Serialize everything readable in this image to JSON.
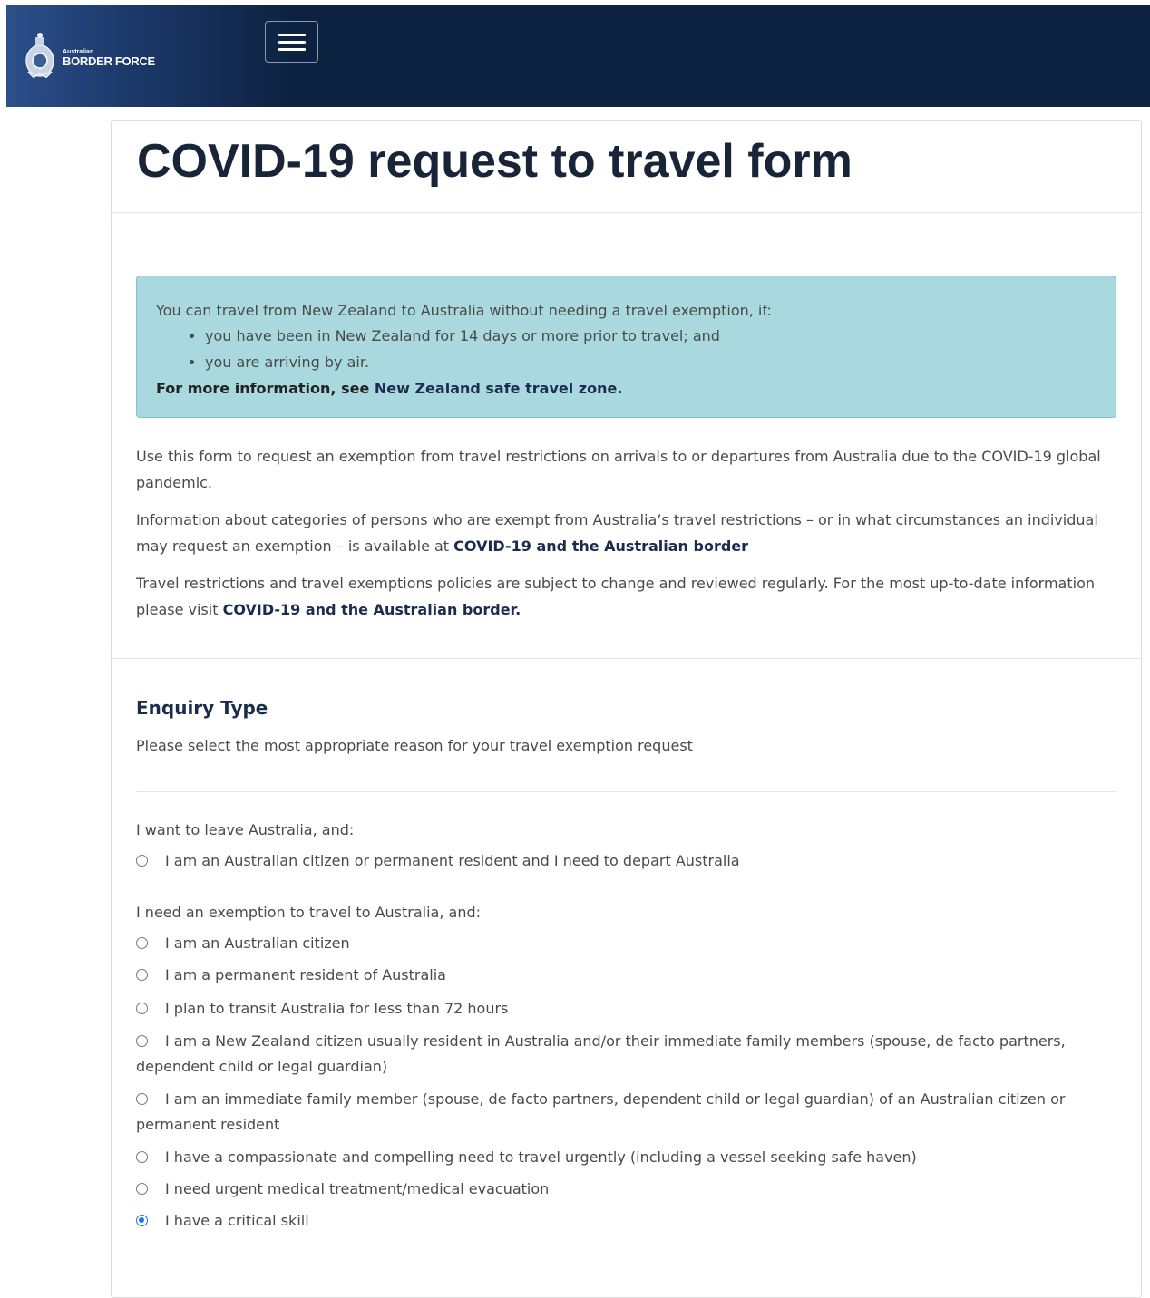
{
  "header": {
    "logo_small": "Australian",
    "logo_big": "BORDER FORCE",
    "menu_icon": "hamburger-menu-icon"
  },
  "page": {
    "title": "COVID-19 request to travel form"
  },
  "alert": {
    "intro": "You can travel from New Zealand to Australia without needing a travel exemption, if:",
    "bullets": [
      "you have been in New Zealand for 14 days or more prior to travel; and",
      "you are arriving by air."
    ],
    "more_prefix": "For more information, see ",
    "more_link": "New Zealand safe travel zone."
  },
  "intro": {
    "p1": "Use this form to request an exemption from travel restrictions on arrivals to or departures from Australia due to the COVID-19 global pandemic.",
    "p2_text": "Information about categories of persons who are exempt from Australia’s travel restrictions – or in what circumstances an individual may request an exemption – is available at ",
    "p2_link": "COVID-19 and the Australian border",
    "p3_text": "Travel restrictions and travel exemptions policies are subject to change and reviewed regularly. For the most up-to-date information please visit ",
    "p3_link": "COVID-19 and the Australian border."
  },
  "enquiry": {
    "title": "Enquiry Type",
    "description": "Please select the most appropriate reason for your travel exemption request",
    "group1_label": "I want to leave Australia, and:",
    "group1_options": [
      {
        "label": "I am an Australian citizen or permanent resident and I need to depart Australia",
        "checked": false
      }
    ],
    "group2_label": "I need an exemption to travel to Australia, and:",
    "group2_options": [
      {
        "label": "I am an Australian citizen",
        "checked": false
      },
      {
        "label": "I am a permanent resident of Australia",
        "checked": false
      },
      {
        "label": "I plan to transit Australia for less than 72 hours",
        "checked": false
      },
      {
        "label": "I am a New Zealand citizen usually resident in Australia and/or their immediate family members (spouse, de facto partners, dependent child or legal guardian)",
        "checked": false
      },
      {
        "label": "I am an immediate family member (spouse, de facto partners, dependent child or legal guardian) of an Australian citizen or permanent resident",
        "checked": false
      },
      {
        "label": "I have a compassionate and compelling need to travel urgently (including a vessel seeking safe haven)",
        "checked": false
      },
      {
        "label": "I need urgent medical treatment/medical evacuation",
        "checked": false
      },
      {
        "label": "I have a critical skill",
        "checked": true
      }
    ]
  },
  "colors": {
    "header_bg": "#0d2240",
    "alert_bg": "#a9d9df",
    "link": "#1c2c4e",
    "radio_selected": "#1a73e8"
  }
}
